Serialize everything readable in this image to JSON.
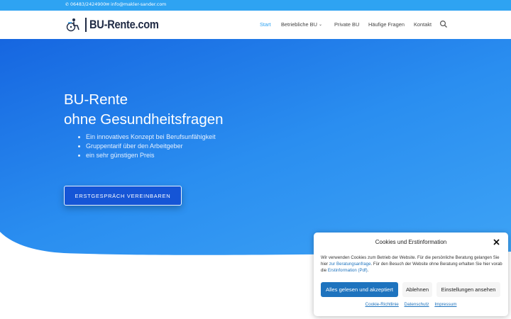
{
  "topbar": {
    "phone": "06483/2424900",
    "email": "info@makler-sander.com",
    "phone_icon": "phone-icon",
    "email_icon": "envelope-icon"
  },
  "header": {
    "logo_text": "BU-Rente.com",
    "nav": [
      {
        "label": "Start",
        "active": true
      },
      {
        "label": "Betriebliche BU",
        "has_dropdown": true
      },
      {
        "label": "Private BU"
      },
      {
        "label": "Häufige Fragen"
      },
      {
        "label": "Kontakt"
      }
    ],
    "search_icon": "search-icon"
  },
  "hero": {
    "title_line1": "BU-Rente",
    "title_line2": "ohne Gesundheitsfragen",
    "bullets": [
      "Ein innovatives Konzept bei Berufsunfähigkeit",
      "Gruppentarif über den Arbeitgeber",
      "ein sehr günstigen Preis"
    ],
    "cta_label": "ERSTGESPRÄCH VEREINBAREN"
  },
  "cookie": {
    "title": "Cookies und Erstinformation",
    "text_part1": "Wir verwenden Cookies zum Betrieb der Website. Für die persönliche Beratung gelangen Sie hier ",
    "link1": "zur Beratungsanfrage",
    "text_part2": ". Für den Besuch der Website ohne Beratung erhalten Sie hier vorab die ",
    "link2": "Erstinformation (Pdf)",
    "text_part3": ".",
    "accept_label": "Alles gelesen und akzeptiert",
    "deny_label": "Ablehnen",
    "settings_label": "Einstellungen ansehen",
    "links": [
      "Cookie-Richtlinie",
      "Datenschutz",
      "Impressum"
    ]
  },
  "colors": {
    "accent": "#2ea3f2",
    "hero_start": "#1666e0",
    "hero_end": "#44aaf7",
    "cta_bg": "#1555d6",
    "cookie_button": "#1e73be"
  }
}
